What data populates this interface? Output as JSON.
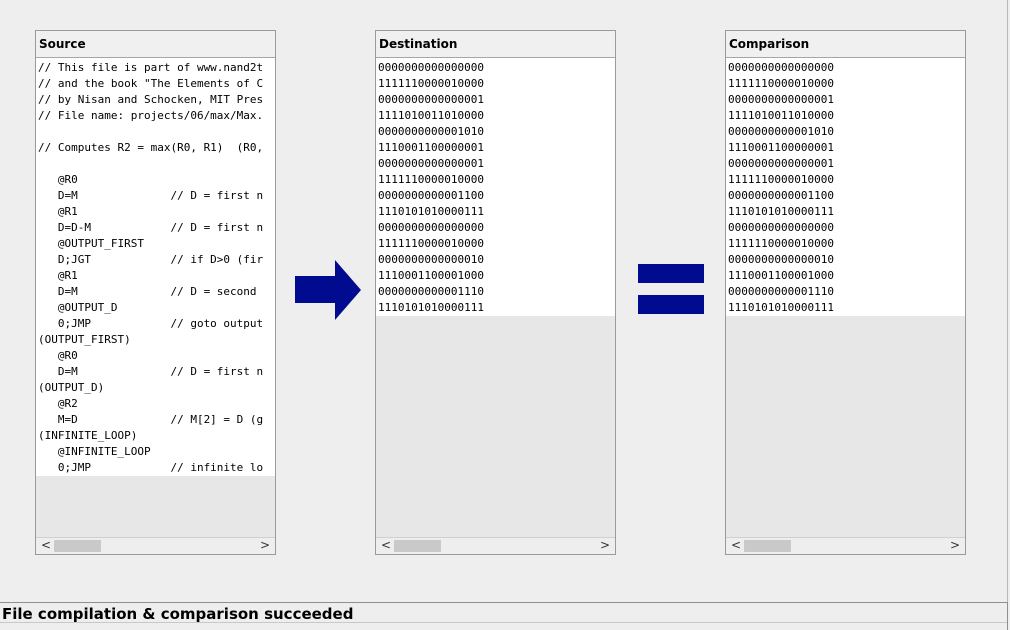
{
  "panels": {
    "source": {
      "title": "Source",
      "lines": [
        "// This file is part of www.nand2t",
        "// and the book \"The Elements of C",
        "// by Nisan and Schocken, MIT Pres",
        "// File name: projects/06/max/Max.",
        "",
        "// Computes R2 = max(R0, R1)  (R0,",
        "",
        "   @R0",
        "   D=M              // D = first n",
        "   @R1",
        "   D=D-M            // D = first n",
        "   @OUTPUT_FIRST",
        "   D;JGT            // if D>0 (fir",
        "   @R1",
        "   D=M              // D = second ",
        "   @OUTPUT_D",
        "   0;JMP            // goto output",
        "(OUTPUT_FIRST)",
        "   @R0",
        "   D=M              // D = first n",
        "(OUTPUT_D)",
        "   @R2",
        "   M=D              // M[2] = D (g",
        "(INFINITE_LOOP)",
        "   @INFINITE_LOOP",
        "   0;JMP            // infinite lo"
      ]
    },
    "destination": {
      "title": "Destination",
      "lines": [
        "0000000000000000",
        "1111110000010000",
        "0000000000000001",
        "1111010011010000",
        "0000000000001010",
        "1110001100000001",
        "0000000000000001",
        "1111110000010000",
        "0000000000001100",
        "1110101010000111",
        "0000000000000000",
        "1111110000010000",
        "0000000000000010",
        "1110001100001000",
        "0000000000001110",
        "1110101010000111"
      ]
    },
    "comparison": {
      "title": "Comparison",
      "lines": [
        "0000000000000000",
        "1111110000010000",
        "0000000000000001",
        "1111010011010000",
        "0000000000001010",
        "1110001100000001",
        "0000000000000001",
        "1111110000010000",
        "0000000000001100",
        "1110101010000111",
        "0000000000000000",
        "1111110000010000",
        "0000000000000010",
        "1110001100001000",
        "0000000000001110",
        "1110101010000111"
      ]
    }
  },
  "scroll": {
    "left_arrow": "<",
    "right_arrow": ">"
  },
  "icons": {
    "translate_arrow": "right-arrow-icon",
    "equals_sign": "equals-icon"
  },
  "colors": {
    "icon_blue": "#000b8f"
  },
  "status": {
    "message": "File compilation & comparison succeeded"
  }
}
